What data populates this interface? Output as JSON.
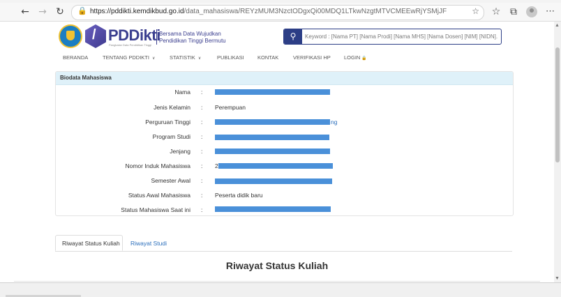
{
  "browser": {
    "url_host": "https://pddikti.kemdikbud.go.id",
    "url_path": "/data_mahasiswa/REYzMUM3NzctODgxQi00MDQ1LTkwNzgtMTVCMEEwRjYSMjJF",
    "icons": [
      "back-icon",
      "forward-icon",
      "refresh-icon",
      "lock-icon",
      "star-icon",
      "favorites-icon",
      "collections-icon",
      "profile-icon",
      "more-icon"
    ]
  },
  "header": {
    "brand": "PDDikti",
    "brand_sub": "Pangkalan Data Pendidikan Tinggi",
    "tagline_1": "Bersama Data Wujudkan",
    "tagline_2": "Pendidikan Tinggi Bermutu",
    "search_placeholder": "Keyword : [Nama PT] [Nama Prodi] [Nama MHS] [Nama Dosen] [NIM] [NIDN]."
  },
  "nav": {
    "beranda": "BERANDA",
    "tentang": "TENTANG PDDIKTI",
    "statistik": "STATISTIK",
    "publikasi": "PUBLIKASI",
    "kontak": "KONTAK",
    "verifikasi": "VERIFIKASI HP",
    "login": "LOGIN"
  },
  "biodata": {
    "title": "Biodata Mahasiswa",
    "rows": [
      {
        "label": "Nama",
        "value": ""
      },
      {
        "label": "Jenis Kelamin",
        "value": "Perempuan"
      },
      {
        "label": "Perguruan Tinggi",
        "value": "ng"
      },
      {
        "label": "Program Studi",
        "value": ""
      },
      {
        "label": "Jenjang",
        "value": ""
      },
      {
        "label": "Nomor Induk Mahasiswa",
        "value": "2"
      },
      {
        "label": "Semester Awal",
        "value": ""
      },
      {
        "label": "Status Awal Mahasiswa",
        "value": "Peserta didik baru"
      },
      {
        "label": "Status Mahasiswa Saat ini",
        "value": ""
      }
    ]
  },
  "tabs": {
    "riwayat_status": "Riwayat Status Kuliah",
    "riwayat_studi": "Riwayat Studi"
  },
  "section": {
    "title": "Riwayat Status Kuliah"
  },
  "colors": {
    "brand": "#3b3f8f",
    "search_border": "#2c3e86",
    "panel_header": "#dff1f9",
    "link": "#2a6ebb",
    "redaction": "#4a90d9"
  }
}
